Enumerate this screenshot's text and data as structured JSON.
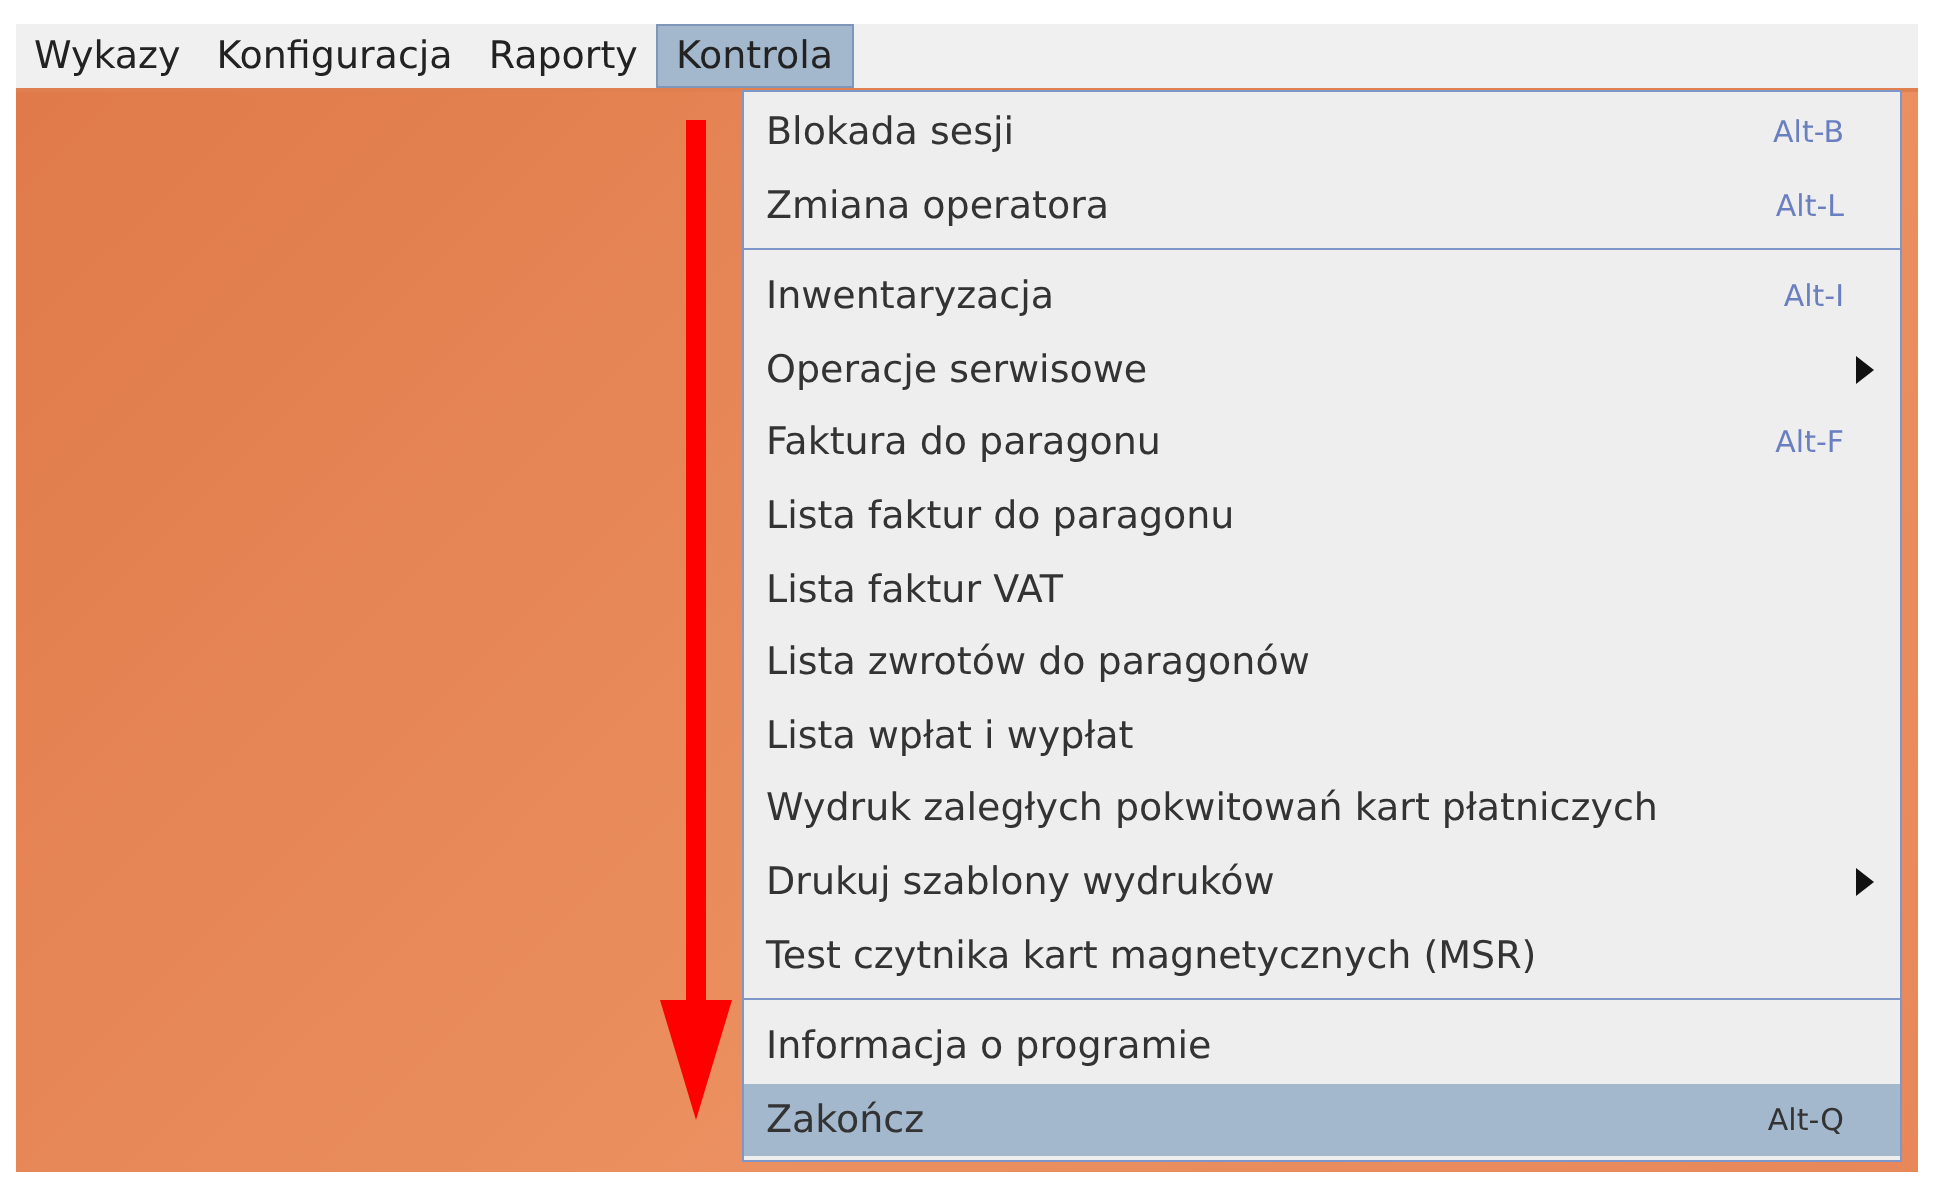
{
  "menubar": [
    {
      "label": "Wykazy",
      "selected": false
    },
    {
      "label": "Konfiguracja",
      "selected": false
    },
    {
      "label": "Raporty",
      "selected": false
    },
    {
      "label": "Kontrola",
      "selected": true
    }
  ],
  "menu": {
    "items": [
      {
        "kind": "item",
        "label": "Blokada sesji",
        "shortcut": "Alt-B",
        "submenu": false,
        "selected": false
      },
      {
        "kind": "item",
        "label": "Zmiana operatora",
        "shortcut": "Alt-L",
        "submenu": false,
        "selected": false
      },
      {
        "kind": "separator"
      },
      {
        "kind": "item",
        "label": "Inwentaryzacja",
        "shortcut": "Alt-I",
        "submenu": false,
        "selected": false
      },
      {
        "kind": "item",
        "label": "Operacje serwisowe",
        "submenu": true,
        "selected": false
      },
      {
        "kind": "item",
        "label": "Faktura do paragonu",
        "shortcut": "Alt-F",
        "submenu": false,
        "selected": false
      },
      {
        "kind": "item",
        "label": "Lista faktur do paragonu",
        "submenu": false,
        "selected": false
      },
      {
        "kind": "item",
        "label": "Lista faktur VAT",
        "submenu": false,
        "selected": false
      },
      {
        "kind": "item",
        "label": "Lista zwrotów do paragonów",
        "submenu": false,
        "selected": false
      },
      {
        "kind": "item",
        "label": "Lista wpłat i wypłat",
        "submenu": false,
        "selected": false
      },
      {
        "kind": "item",
        "label": "Wydruk zaległych pokwitowań kart płatniczych",
        "submenu": false,
        "selected": false
      },
      {
        "kind": "item",
        "label": "Drukuj szablony wydruków",
        "submenu": true,
        "selected": false
      },
      {
        "kind": "item",
        "label": "Test czytnika kart magnetycznych (MSR)",
        "submenu": false,
        "selected": false
      },
      {
        "kind": "separator"
      },
      {
        "kind": "item",
        "label": "Informacja o programie",
        "submenu": false,
        "selected": false
      },
      {
        "kind": "item",
        "label": "Zakończ",
        "shortcut": "Alt-Q",
        "submenu": false,
        "selected": true
      }
    ]
  }
}
